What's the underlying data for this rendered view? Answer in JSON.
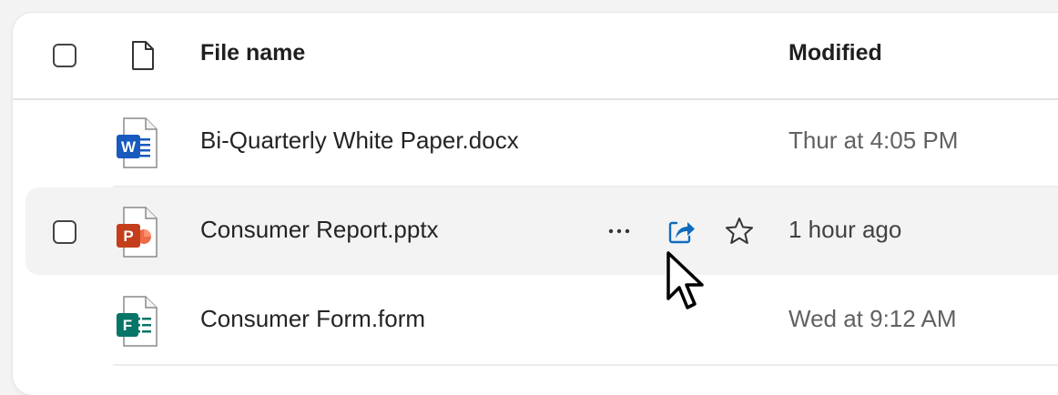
{
  "header": {
    "file_name_label": "File name",
    "modified_label": "Modified"
  },
  "rows": [
    {
      "name": "Bi-Quarterly White Paper.docx",
      "modified": "Thur at 4:05 PM",
      "icon": "word-file-icon",
      "icon_letter": "W",
      "accent": "#185abd"
    },
    {
      "name": "Consumer Report.pptx",
      "modified": "1 hour ago",
      "icon": "powerpoint-file-icon",
      "icon_letter": "P",
      "accent": "#c43e1c",
      "hovered": true
    },
    {
      "name": "Consumer Form.form",
      "modified": "Wed at 9:12 AM",
      "icon": "forms-file-icon",
      "icon_letter": "F",
      "accent": "#077568"
    }
  ],
  "row_actions": [
    "more-options-icon",
    "share-icon",
    "favorite-star-icon"
  ]
}
